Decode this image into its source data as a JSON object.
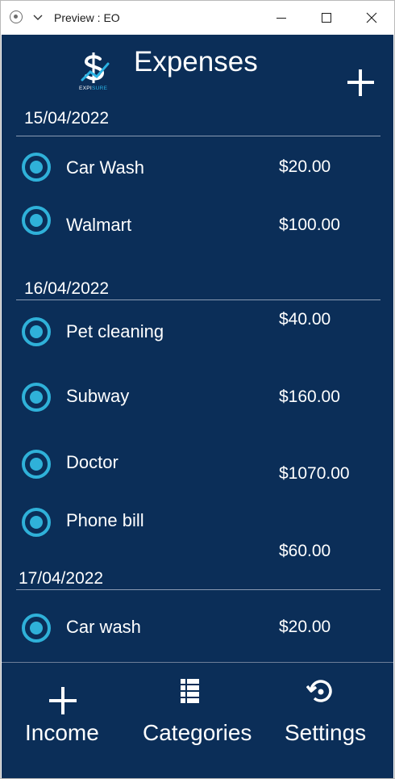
{
  "window": {
    "title": "Preview : EO",
    "controls": [
      "minimize-icon",
      "maximize-icon",
      "close-icon"
    ]
  },
  "header": {
    "logo_text_left": "EXPI",
    "logo_text_right": "SURE",
    "title": "Expenses",
    "add_icon": "plus-icon"
  },
  "groups": [
    {
      "date": "15/04/2022",
      "items": [
        {
          "name": "Car Wash",
          "amount": "$20.00"
        },
        {
          "name": "Walmart",
          "amount": "$100.00"
        }
      ]
    },
    {
      "date": "16/04/2022",
      "items": [
        {
          "name": "Pet cleaning",
          "amount": "$40.00"
        },
        {
          "name": "Subway",
          "amount": "$160.00"
        },
        {
          "name": "Doctor",
          "amount": "$1070.00"
        },
        {
          "name": "Phone bill",
          "amount": "$60.00"
        }
      ]
    },
    {
      "date": "17/04/2022",
      "items": [
        {
          "name": "Car wash",
          "amount": "$20.00"
        }
      ]
    }
  ],
  "nav": {
    "income": {
      "label": "Income",
      "icon": "plus-icon"
    },
    "categories": {
      "label": "Categories",
      "icon": "list-icon"
    },
    "settings": {
      "label": "Settings",
      "icon": "history-icon"
    }
  },
  "colors": {
    "background": "#0b2e58",
    "accent": "#2fb1d9",
    "text": "#ffffff"
  }
}
